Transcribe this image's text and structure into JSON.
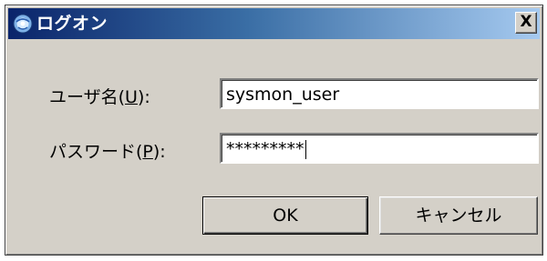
{
  "window": {
    "title": "ログオン",
    "close_glyph": "X"
  },
  "form": {
    "username_label_prefix": "ユーザ名(",
    "username_label_mnemonic": "U",
    "username_label_suffix": "):",
    "username_value": "sysmon_user",
    "password_label_prefix": "パスワード(",
    "password_label_mnemonic": "P",
    "password_label_suffix": "):",
    "password_masked": "*********"
  },
  "buttons": {
    "ok_label": "OK",
    "cancel_label": "キャンセル"
  },
  "icons": {
    "title_icon": "logon-globe-icon"
  },
  "colors": {
    "titlebar_start": "#0a246a",
    "titlebar_end": "#a6caf0",
    "dialog_face": "#d4d0c8"
  }
}
